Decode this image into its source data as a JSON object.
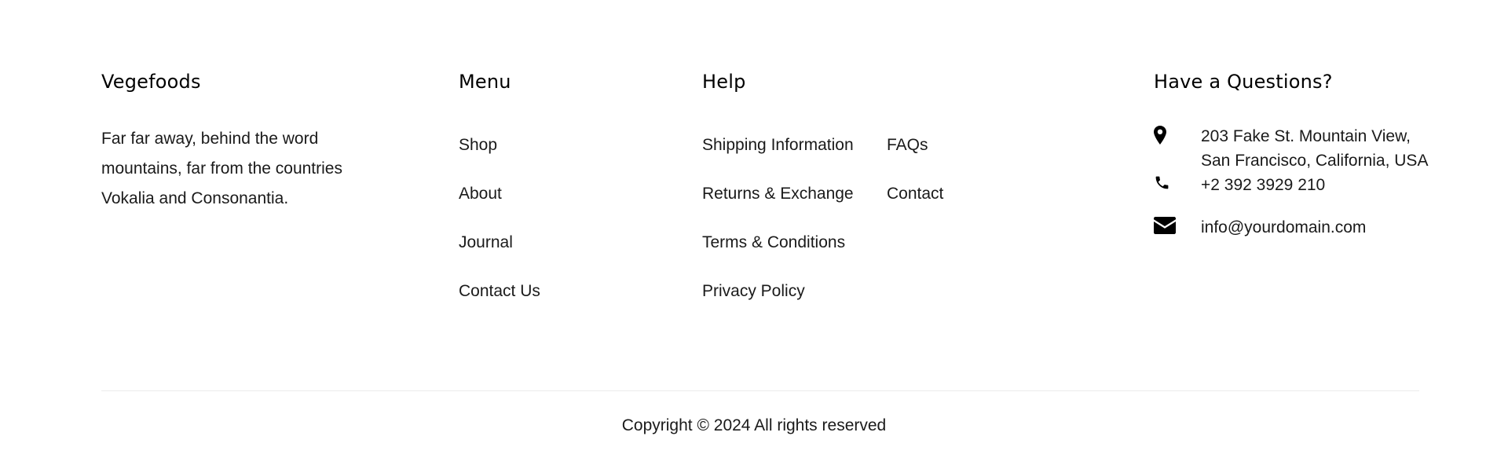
{
  "brand": {
    "title": "Vegefoods",
    "description": "Far far away, behind the word mountains, far from the countries Vokalia and Consonantia."
  },
  "menu": {
    "title": "Menu",
    "items": [
      "Shop",
      "About",
      "Journal",
      "Contact Us"
    ]
  },
  "help": {
    "title": "Help",
    "column_a": [
      "Shipping Information",
      "Returns & Exchange",
      "Terms & Conditions",
      "Privacy Policy"
    ],
    "column_b": [
      "FAQs",
      "Contact"
    ]
  },
  "contact": {
    "title": "Have a Questions?",
    "address": "203 Fake St. Mountain View, San Francisco, California, USA",
    "phone": "+2 392 3929 210",
    "email": "info@yourdomain.com",
    "icons": {
      "address": "map-marker-icon",
      "phone": "phone-icon",
      "email": "envelope-icon"
    }
  },
  "copyright": "Copyright © 2024 All rights reserved",
  "colors": {
    "heading": "#000000",
    "text": "#1a1a1a",
    "divider": "#ececec"
  }
}
